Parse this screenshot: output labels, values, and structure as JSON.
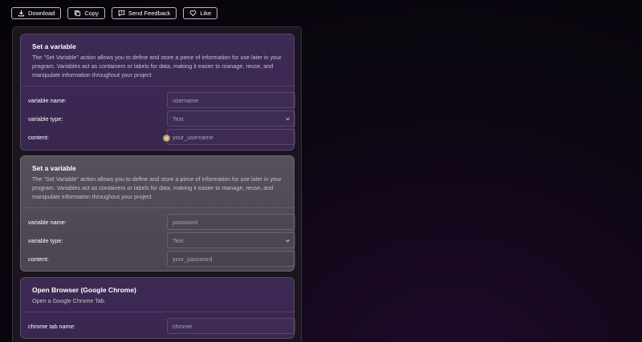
{
  "toolbar": {
    "download_label": "Download",
    "copy_label": "Copy",
    "feedback_label": "Send Feedback",
    "like_label": "Like"
  },
  "cards": [
    {
      "title": "Set a variable",
      "description": "The \"Set Variable\" action allows you to define and store a piece of information for use later in your program. Variables act as containers or labels for data, making it easier to manage, reuse, and manipulate information throughout your project.",
      "fields": [
        {
          "label": "variable name:",
          "value": "username"
        },
        {
          "label": "variable type:",
          "value": "Text"
        },
        {
          "label": "content:",
          "value": "your_username"
        }
      ]
    },
    {
      "title": "Set a variable",
      "description": "The \"Set Variable\" action allows you to define and store a piece of information for use later in your program. Variables act as containers or labels for data, making it easier to manage, reuse, and manipulate information throughout your project.",
      "fields": [
        {
          "label": "variable name:",
          "value": "password"
        },
        {
          "label": "variable type:",
          "value": "Text"
        },
        {
          "label": "content:",
          "value": "your_password"
        }
      ]
    },
    {
      "title": "Open Browser (Google Chrome)",
      "description": "Open a Google Chrome Tab.",
      "fields": [
        {
          "label": "chrome tab name:",
          "value": "chrome"
        }
      ]
    }
  ]
}
